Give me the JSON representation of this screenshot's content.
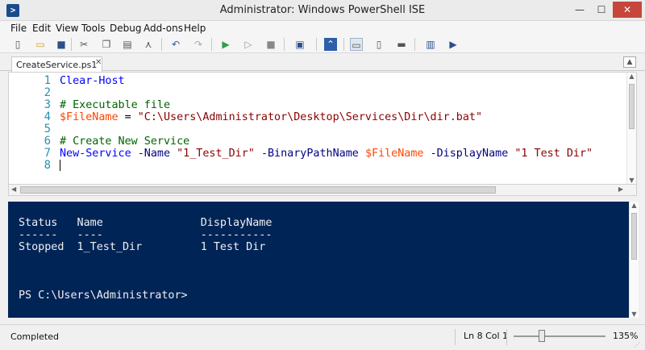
{
  "window": {
    "title": "Administrator: Windows PowerShell ISE",
    "app_icon_glyph": ">",
    "minimize_glyph": "—",
    "maximize_glyph": "☐",
    "close_glyph": "✕"
  },
  "menu": [
    "File",
    "Edit",
    "View",
    "Tools",
    "Debug",
    "Add-ons",
    "Help"
  ],
  "toolbar": {
    "icons": [
      {
        "name": "new-script-icon",
        "glyph": "▯"
      },
      {
        "name": "open-icon",
        "glyph": "▭"
      },
      {
        "name": "save-icon",
        "glyph": "■"
      },
      {
        "name": "cut-icon",
        "glyph": "✂"
      },
      {
        "name": "copy-icon",
        "glyph": "❐"
      },
      {
        "name": "paste-icon",
        "glyph": "▤"
      },
      {
        "name": "clear-console-icon",
        "glyph": "⋏"
      },
      {
        "name": "undo-icon",
        "glyph": "↶"
      },
      {
        "name": "redo-icon",
        "glyph": "↷"
      },
      {
        "name": "run-script-icon",
        "glyph": "▶"
      },
      {
        "name": "run-selection-icon",
        "glyph": "▷"
      },
      {
        "name": "stop-icon",
        "glyph": "■"
      },
      {
        "name": "remote-powershell-icon",
        "glyph": "▣"
      },
      {
        "name": "powershell-console-icon",
        "glyph": "⌃"
      },
      {
        "name": "show-script-top-icon",
        "glyph": "▭"
      },
      {
        "name": "show-script-right-icon",
        "glyph": "▯"
      },
      {
        "name": "show-script-maximized-icon",
        "glyph": "▬"
      },
      {
        "name": "show-command-window-icon",
        "glyph": "▥"
      },
      {
        "name": "show-command-addon-icon",
        "glyph": "▶"
      }
    ]
  },
  "tabs": [
    {
      "label": "CreateService.ps1",
      "close": "✕"
    }
  ],
  "collapse_glyph": "▲",
  "editor": {
    "line_numbers": [
      "1",
      "2",
      "3",
      "4",
      "5",
      "6",
      "7",
      "8"
    ],
    "lines": [
      [
        {
          "t": "cmd",
          "v": "Clear-Host"
        }
      ],
      [],
      [
        {
          "t": "cmt",
          "v": "# Executable file"
        }
      ],
      [
        {
          "t": "var",
          "v": "$FileName"
        },
        {
          "t": "plain",
          "v": " = "
        },
        {
          "t": "str",
          "v": "\"C:\\Users\\Administrator\\Desktop\\Services\\Dir\\dir.bat\""
        }
      ],
      [],
      [
        {
          "t": "cmt",
          "v": "# Create New Service"
        }
      ],
      [
        {
          "t": "cmd",
          "v": "New-Service"
        },
        {
          "t": "plain",
          "v": " "
        },
        {
          "t": "prm",
          "v": "-Name"
        },
        {
          "t": "plain",
          "v": " "
        },
        {
          "t": "str",
          "v": "\"1_Test_Dir\""
        },
        {
          "t": "plain",
          "v": " "
        },
        {
          "t": "prm",
          "v": "-BinaryPathName"
        },
        {
          "t": "plain",
          "v": " "
        },
        {
          "t": "var",
          "v": "$FileName"
        },
        {
          "t": "plain",
          "v": " "
        },
        {
          "t": "prm",
          "v": "-DisplayName"
        },
        {
          "t": "plain",
          "v": " "
        },
        {
          "t": "str",
          "v": "\"1 Test Dir\""
        }
      ],
      []
    ]
  },
  "console": {
    "lines": [
      "",
      "Status   Name               DisplayName",
      "------   ----               -----------",
      "Stopped  1_Test_Dir         1 Test Dir",
      "",
      "",
      "",
      "PS C:\\Users\\Administrator>"
    ]
  },
  "status": {
    "text": "Completed",
    "position": "Ln 8  Col 1",
    "zoom": "135%",
    "zoom_fraction": 0.31
  },
  "colors": {
    "console_bg": "#012456",
    "close_button": "#c7463b"
  }
}
